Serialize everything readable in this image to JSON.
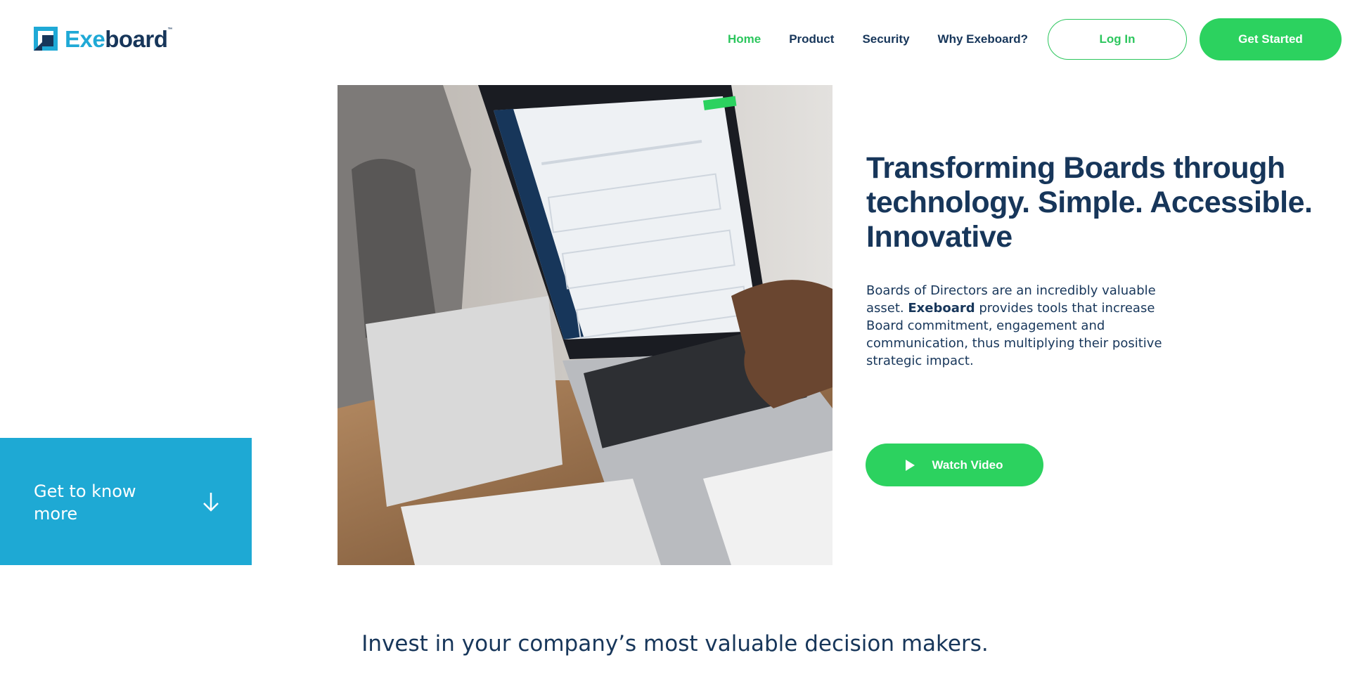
{
  "brand": {
    "logo_exe": "Exe",
    "logo_board": "board",
    "logo_tm": "™"
  },
  "nav": {
    "items": [
      {
        "label": "Home",
        "active": true
      },
      {
        "label": "Product",
        "active": false
      },
      {
        "label": "Security",
        "active": false
      },
      {
        "label": "Why Exeboard?",
        "active": false
      }
    ],
    "login_label": "Log In",
    "get_started_label": "Get Started"
  },
  "hero": {
    "image_icon": "laptop-photo",
    "headline": "Transforming Boards through technology. Simple. Accessible. Innovative",
    "description_part1": "Boards of Directors are an incredibly valuable asset. ",
    "description_brand": "Exeboard",
    "description_part2": " provides tools that increase Board commitment, engagement and communication, thus multiplying their positive strategic impact.",
    "watch_video_label": "Watch Video",
    "watch_icon": "play-icon"
  },
  "get_to_know": {
    "label": "Get to know more",
    "icon": "arrow-down-icon"
  },
  "tagline": "Invest in your company’s most valuable decision makers.",
  "colors": {
    "accent_green": "#2cd25f",
    "brand_blue": "#1ea9d4",
    "navy": "#17365a"
  }
}
